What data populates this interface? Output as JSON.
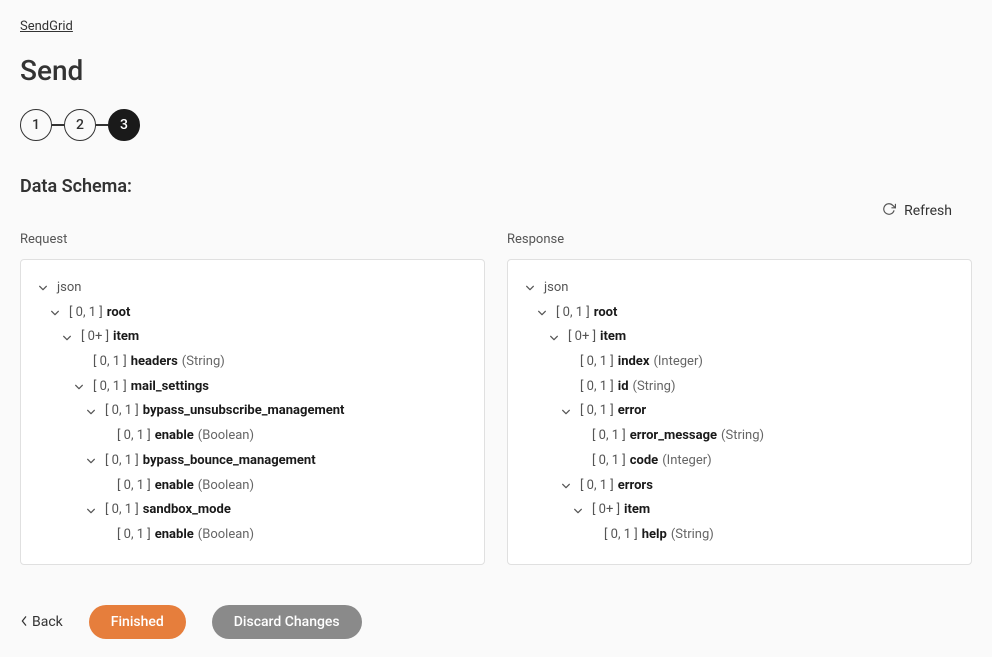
{
  "breadcrumb": "SendGrid",
  "page_title": "Send",
  "stepper": {
    "steps": [
      "1",
      "2",
      "3"
    ],
    "active_index": 2
  },
  "section_title": "Data Schema:",
  "refresh_label": "Refresh",
  "request_label": "Request",
  "response_label": "Response",
  "request_tree": [
    {
      "indent": 0,
      "chevron": true,
      "text": "json",
      "is_json_label": true
    },
    {
      "indent": 1,
      "chevron": true,
      "cardinality": "[ 0, 1 ]",
      "name": "root"
    },
    {
      "indent": 2,
      "chevron": true,
      "cardinality": "[ 0+ ]",
      "name": "item"
    },
    {
      "indent": 3,
      "chevron": false,
      "cardinality": "[ 0, 1 ]",
      "name": "headers",
      "type": "(String)"
    },
    {
      "indent": 3,
      "chevron": true,
      "cardinality": "[ 0, 1 ]",
      "name": "mail_settings"
    },
    {
      "indent": 4,
      "chevron": true,
      "cardinality": "[ 0, 1 ]",
      "name": "bypass_unsubscribe_management"
    },
    {
      "indent": 5,
      "chevron": false,
      "cardinality": "[ 0, 1 ]",
      "name": "enable",
      "type": "(Boolean)"
    },
    {
      "indent": 4,
      "chevron": true,
      "cardinality": "[ 0, 1 ]",
      "name": "bypass_bounce_management"
    },
    {
      "indent": 5,
      "chevron": false,
      "cardinality": "[ 0, 1 ]",
      "name": "enable",
      "type": "(Boolean)"
    },
    {
      "indent": 4,
      "chevron": true,
      "cardinality": "[ 0, 1 ]",
      "name": "sandbox_mode"
    },
    {
      "indent": 5,
      "chevron": false,
      "cardinality": "[ 0, 1 ]",
      "name": "enable",
      "type": "(Boolean)"
    }
  ],
  "response_tree": [
    {
      "indent": 0,
      "chevron": true,
      "text": "json",
      "is_json_label": true
    },
    {
      "indent": 1,
      "chevron": true,
      "cardinality": "[ 0, 1 ]",
      "name": "root"
    },
    {
      "indent": 2,
      "chevron": true,
      "cardinality": "[ 0+ ]",
      "name": "item"
    },
    {
      "indent": 3,
      "chevron": false,
      "cardinality": "[ 0, 1 ]",
      "name": "index",
      "type": "(Integer)"
    },
    {
      "indent": 3,
      "chevron": false,
      "cardinality": "[ 0, 1 ]",
      "name": "id",
      "type": "(String)"
    },
    {
      "indent": 3,
      "chevron": true,
      "cardinality": "[ 0, 1 ]",
      "name": "error"
    },
    {
      "indent": 4,
      "chevron": false,
      "cardinality": "[ 0, 1 ]",
      "name": "error_message",
      "type": "(String)"
    },
    {
      "indent": 4,
      "chevron": false,
      "cardinality": "[ 0, 1 ]",
      "name": "code",
      "type": "(Integer)"
    },
    {
      "indent": 3,
      "chevron": true,
      "cardinality": "[ 0, 1 ]",
      "name": "errors"
    },
    {
      "indent": 4,
      "chevron": true,
      "cardinality": "[ 0+ ]",
      "name": "item"
    },
    {
      "indent": 5,
      "chevron": false,
      "cardinality": "[ 0, 1 ]",
      "name": "help",
      "type": "(String)"
    }
  ],
  "footer": {
    "back_label": "Back",
    "finished_label": "Finished",
    "discard_label": "Discard Changes"
  }
}
